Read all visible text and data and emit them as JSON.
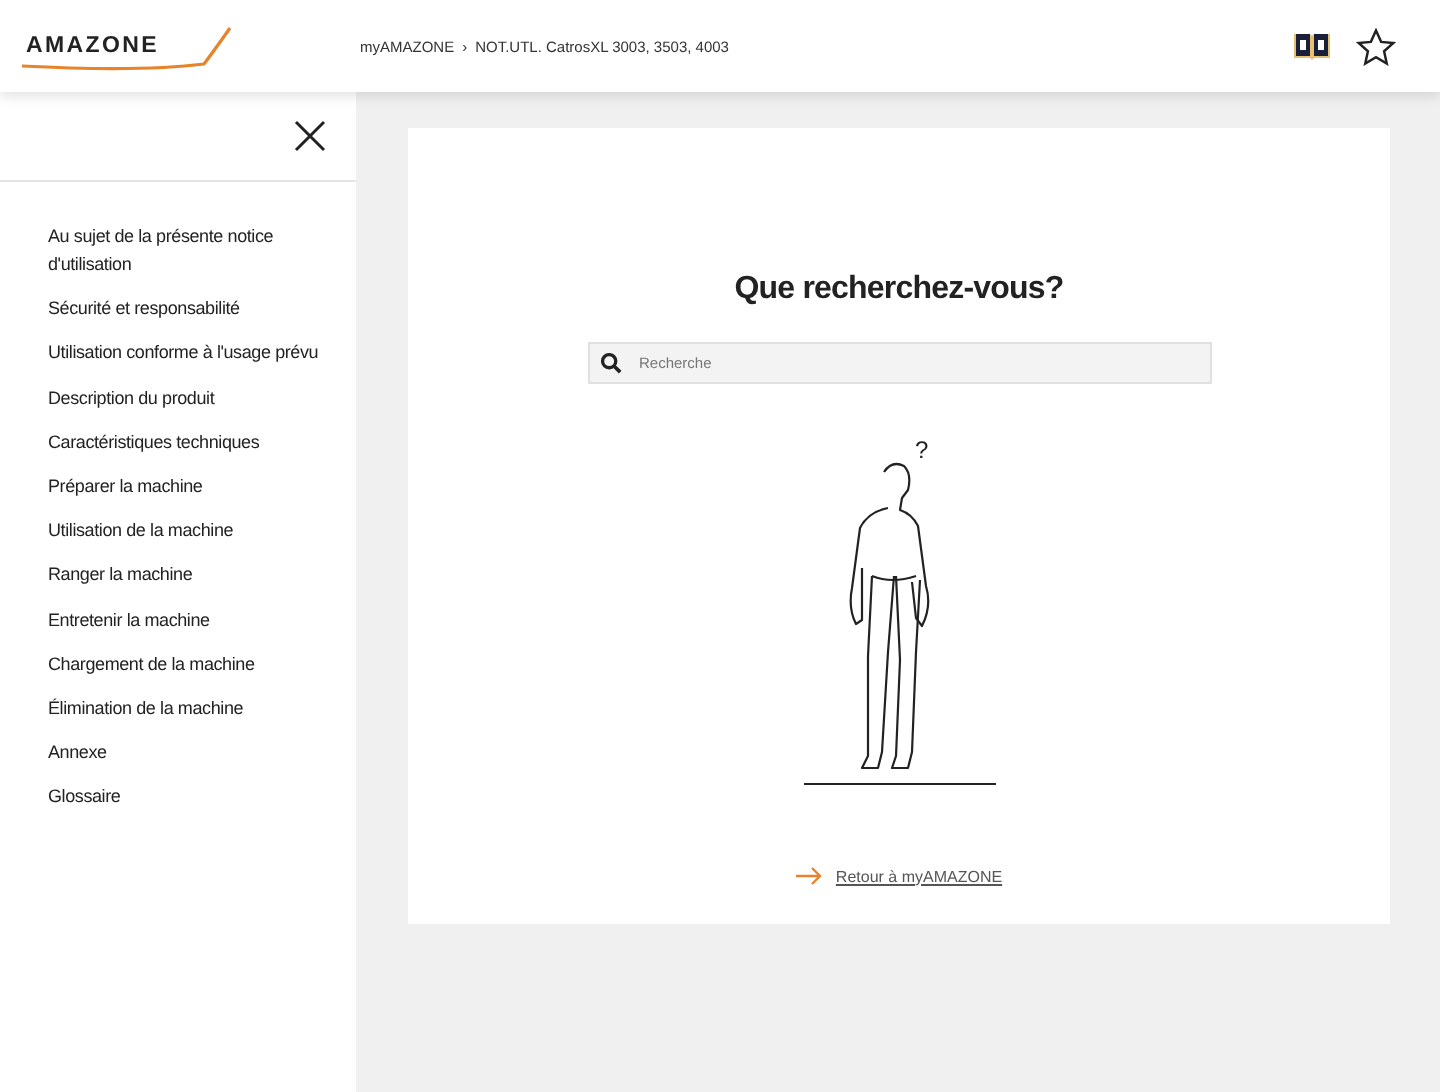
{
  "header": {
    "logo": "AMAZONE",
    "breadcrumb": [
      "myAMAZONE",
      "NOT.UTL. CatrosXL 3003, 3503, 4003"
    ],
    "separator": "›"
  },
  "sidebar": {
    "items": [
      {
        "label": "Au sujet de la présente notice d'utilisation"
      },
      {
        "label": "Sécurité et responsabilité"
      },
      {
        "label": "Utilisation conforme à l'usage prévu"
      },
      {
        "label": "Description du produit"
      },
      {
        "label": "Caractéristiques techniques"
      },
      {
        "label": "Préparer la machine"
      },
      {
        "label": "Utilisation de la machine"
      },
      {
        "label": "Ranger la machine"
      },
      {
        "label": "Entretenir la machine"
      },
      {
        "label": "Chargement de la machine"
      },
      {
        "label": "Élimination de la machine"
      },
      {
        "label": "Annexe"
      },
      {
        "label": "Glossaire"
      }
    ]
  },
  "main": {
    "title": "Que recherchez-vous?",
    "search": {
      "placeholder": "Recherche"
    },
    "question_mark": "?",
    "back_link": "Retour à myAMAZONE"
  }
}
